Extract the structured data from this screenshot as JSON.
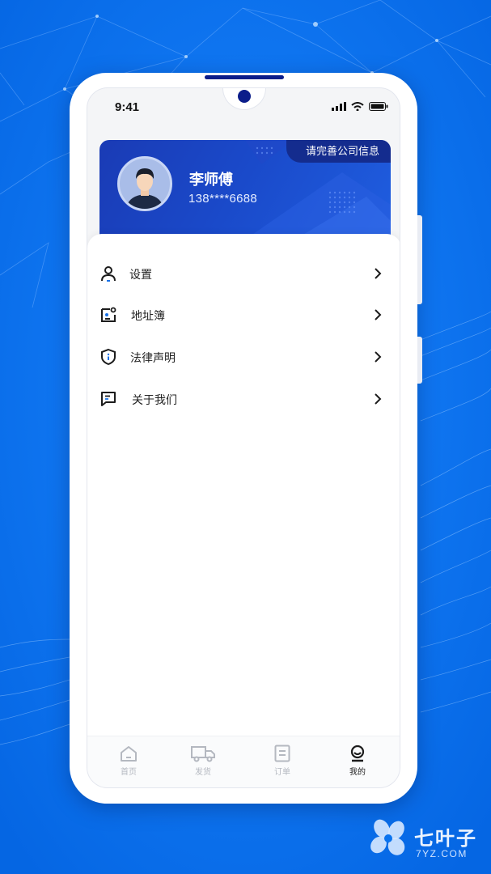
{
  "status_bar": {
    "time": "9:41"
  },
  "profile": {
    "name": "李师傅",
    "phone": "138****6688",
    "complete_info_label": "请完善公司信息"
  },
  "menu": {
    "items": [
      {
        "label": "设置",
        "icon": "user-icon"
      },
      {
        "label": "地址簿",
        "icon": "address-book-icon"
      },
      {
        "label": "法律声明",
        "icon": "shield-info-icon"
      },
      {
        "label": "关于我们",
        "icon": "chat-icon"
      }
    ]
  },
  "tabbar": {
    "tabs": [
      {
        "label": "首页",
        "icon": "home-icon"
      },
      {
        "label": "发货",
        "icon": "truck-icon"
      },
      {
        "label": "订单",
        "icon": "order-icon"
      },
      {
        "label": "我的",
        "icon": "profile-icon",
        "active": true
      }
    ]
  },
  "watermark": {
    "text": "七叶子",
    "sub": "7YZ.COM"
  },
  "colors": {
    "background": "#0a73ef",
    "card": "#1a3bb5",
    "accent_dark": "#142c8e"
  }
}
